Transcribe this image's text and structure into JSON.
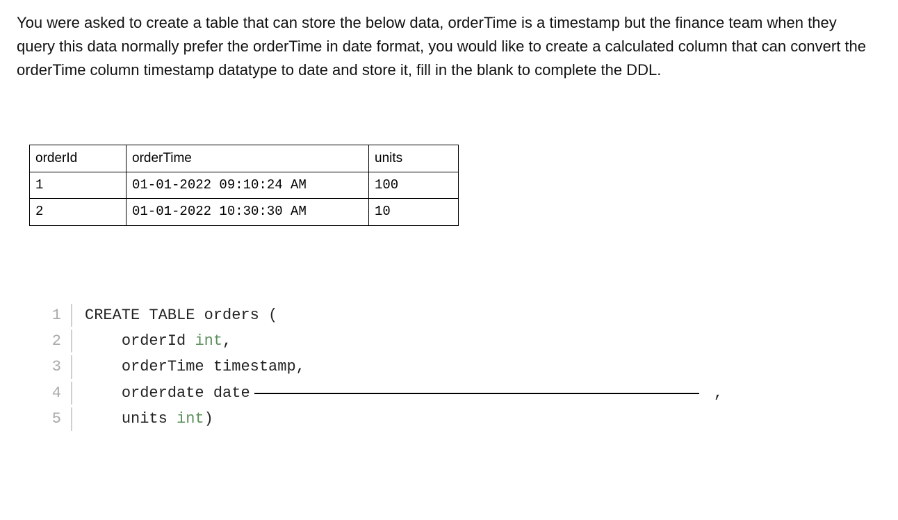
{
  "question": "You were asked to create a table that can store the below data, orderTime is a timestamp but the finance team when they query this data normally prefer the orderTime in date format, you would like to create a calculated column that can convert the orderTime column timestamp datatype to date and store it, fill in the blank to complete the DDL.",
  "table": {
    "headers": [
      "orderId",
      "orderTime",
      "units"
    ],
    "rows": [
      [
        "1",
        "01-01-2022 09:10:24 AM",
        "100"
      ],
      [
        "2",
        "01-01-2022 10:30:30 AM",
        "10"
      ]
    ]
  },
  "code": {
    "lines": [
      {
        "n": "1",
        "prefix": "",
        "text": "CREATE TABLE orders ("
      },
      {
        "n": "2",
        "prefix": "    ",
        "text_a": "orderId ",
        "type": "int",
        "text_b": ","
      },
      {
        "n": "3",
        "prefix": "    ",
        "text_a": "orderTime ",
        "type_plain": "timestamp",
        "text_b": ","
      },
      {
        "n": "4",
        "prefix": "    ",
        "text_a": "orderdate ",
        "type_plain": "date",
        "blank": true,
        "trail": " ,"
      },
      {
        "n": "5",
        "prefix": "    ",
        "text_a": "units ",
        "type": "int",
        "text_b": ")"
      }
    ]
  }
}
